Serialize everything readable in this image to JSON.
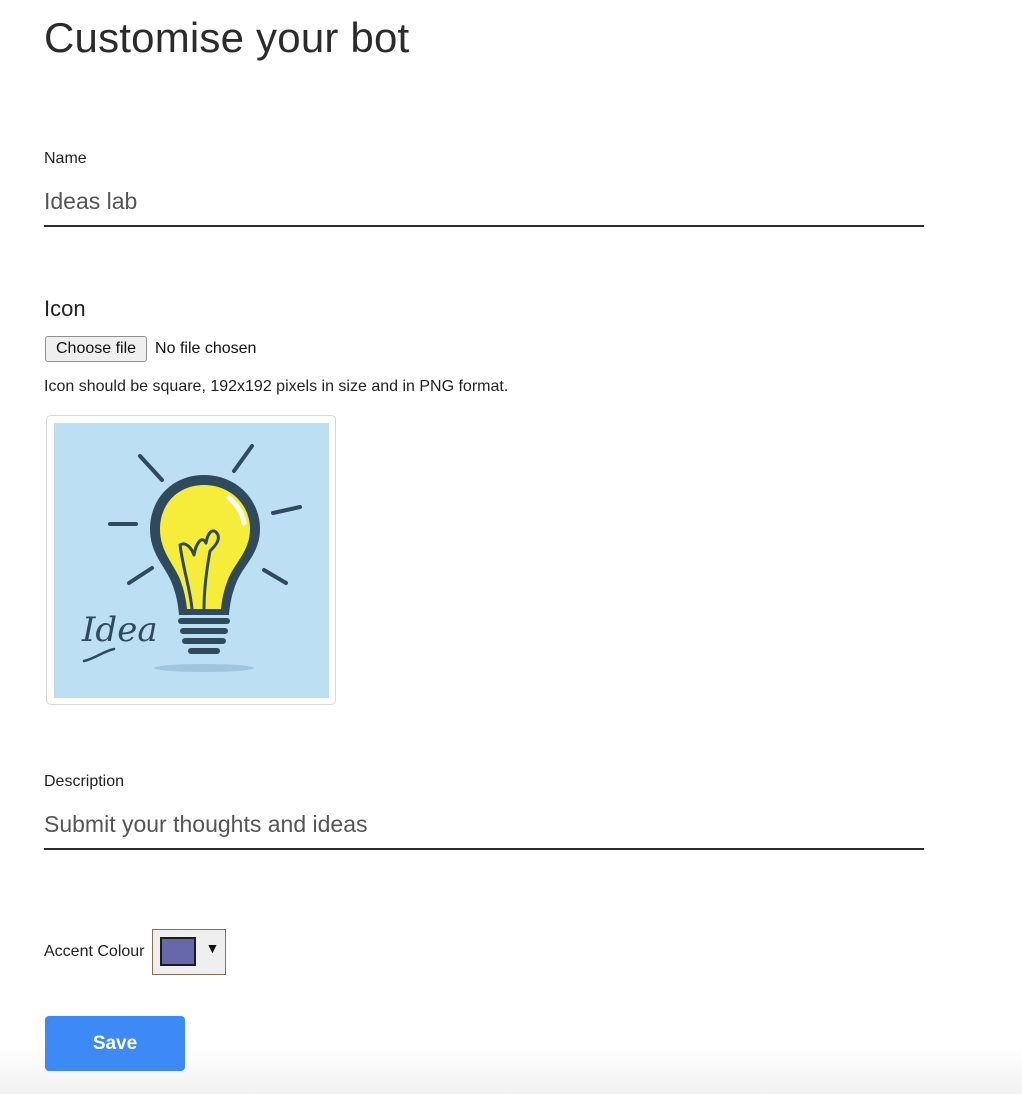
{
  "page": {
    "title": "Customise your bot"
  },
  "name_field": {
    "label": "Name",
    "value": "Ideas lab"
  },
  "icon_field": {
    "label": "Icon",
    "choose_button_label": "Choose file",
    "file_status": "No file chosen",
    "hint": "Icon should be square, 192x192 pixels in size and in PNG format.",
    "preview_icon": "lightbulb-idea-icon",
    "preview_text": "Idea"
  },
  "description_field": {
    "label": "Description",
    "value": "Submit your thoughts and ideas"
  },
  "accent_colour": {
    "label": "Accent Colour",
    "value": "#6668aa",
    "arrow": "▼"
  },
  "actions": {
    "save_label": "Save"
  },
  "colors": {
    "save_button": "#3d8af7",
    "icon_background": "#bddff3",
    "bulb_yellow": "#f6ec3a",
    "bulb_outline": "#2f4a5c"
  }
}
